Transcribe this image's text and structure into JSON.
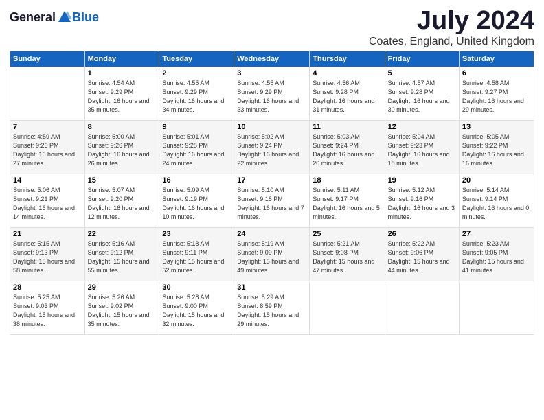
{
  "header": {
    "logo_general": "General",
    "logo_blue": "Blue",
    "month": "July 2024",
    "location": "Coates, England, United Kingdom"
  },
  "days_of_week": [
    "Sunday",
    "Monday",
    "Tuesday",
    "Wednesday",
    "Thursday",
    "Friday",
    "Saturday"
  ],
  "weeks": [
    [
      {
        "day": "",
        "sunrise": "",
        "sunset": "",
        "daylight": ""
      },
      {
        "day": "1",
        "sunrise": "Sunrise: 4:54 AM",
        "sunset": "Sunset: 9:29 PM",
        "daylight": "Daylight: 16 hours and 35 minutes."
      },
      {
        "day": "2",
        "sunrise": "Sunrise: 4:55 AM",
        "sunset": "Sunset: 9:29 PM",
        "daylight": "Daylight: 16 hours and 34 minutes."
      },
      {
        "day": "3",
        "sunrise": "Sunrise: 4:55 AM",
        "sunset": "Sunset: 9:29 PM",
        "daylight": "Daylight: 16 hours and 33 minutes."
      },
      {
        "day": "4",
        "sunrise": "Sunrise: 4:56 AM",
        "sunset": "Sunset: 9:28 PM",
        "daylight": "Daylight: 16 hours and 31 minutes."
      },
      {
        "day": "5",
        "sunrise": "Sunrise: 4:57 AM",
        "sunset": "Sunset: 9:28 PM",
        "daylight": "Daylight: 16 hours and 30 minutes."
      },
      {
        "day": "6",
        "sunrise": "Sunrise: 4:58 AM",
        "sunset": "Sunset: 9:27 PM",
        "daylight": "Daylight: 16 hours and 29 minutes."
      }
    ],
    [
      {
        "day": "7",
        "sunrise": "Sunrise: 4:59 AM",
        "sunset": "Sunset: 9:26 PM",
        "daylight": "Daylight: 16 hours and 27 minutes."
      },
      {
        "day": "8",
        "sunrise": "Sunrise: 5:00 AM",
        "sunset": "Sunset: 9:26 PM",
        "daylight": "Daylight: 16 hours and 26 minutes."
      },
      {
        "day": "9",
        "sunrise": "Sunrise: 5:01 AM",
        "sunset": "Sunset: 9:25 PM",
        "daylight": "Daylight: 16 hours and 24 minutes."
      },
      {
        "day": "10",
        "sunrise": "Sunrise: 5:02 AM",
        "sunset": "Sunset: 9:24 PM",
        "daylight": "Daylight: 16 hours and 22 minutes."
      },
      {
        "day": "11",
        "sunrise": "Sunrise: 5:03 AM",
        "sunset": "Sunset: 9:24 PM",
        "daylight": "Daylight: 16 hours and 20 minutes."
      },
      {
        "day": "12",
        "sunrise": "Sunrise: 5:04 AM",
        "sunset": "Sunset: 9:23 PM",
        "daylight": "Daylight: 16 hours and 18 minutes."
      },
      {
        "day": "13",
        "sunrise": "Sunrise: 5:05 AM",
        "sunset": "Sunset: 9:22 PM",
        "daylight": "Daylight: 16 hours and 16 minutes."
      }
    ],
    [
      {
        "day": "14",
        "sunrise": "Sunrise: 5:06 AM",
        "sunset": "Sunset: 9:21 PM",
        "daylight": "Daylight: 16 hours and 14 minutes."
      },
      {
        "day": "15",
        "sunrise": "Sunrise: 5:07 AM",
        "sunset": "Sunset: 9:20 PM",
        "daylight": "Daylight: 16 hours and 12 minutes."
      },
      {
        "day": "16",
        "sunrise": "Sunrise: 5:09 AM",
        "sunset": "Sunset: 9:19 PM",
        "daylight": "Daylight: 16 hours and 10 minutes."
      },
      {
        "day": "17",
        "sunrise": "Sunrise: 5:10 AM",
        "sunset": "Sunset: 9:18 PM",
        "daylight": "Daylight: 16 hours and 7 minutes."
      },
      {
        "day": "18",
        "sunrise": "Sunrise: 5:11 AM",
        "sunset": "Sunset: 9:17 PM",
        "daylight": "Daylight: 16 hours and 5 minutes."
      },
      {
        "day": "19",
        "sunrise": "Sunrise: 5:12 AM",
        "sunset": "Sunset: 9:16 PM",
        "daylight": "Daylight: 16 hours and 3 minutes."
      },
      {
        "day": "20",
        "sunrise": "Sunrise: 5:14 AM",
        "sunset": "Sunset: 9:14 PM",
        "daylight": "Daylight: 16 hours and 0 minutes."
      }
    ],
    [
      {
        "day": "21",
        "sunrise": "Sunrise: 5:15 AM",
        "sunset": "Sunset: 9:13 PM",
        "daylight": "Daylight: 15 hours and 58 minutes."
      },
      {
        "day": "22",
        "sunrise": "Sunrise: 5:16 AM",
        "sunset": "Sunset: 9:12 PM",
        "daylight": "Daylight: 15 hours and 55 minutes."
      },
      {
        "day": "23",
        "sunrise": "Sunrise: 5:18 AM",
        "sunset": "Sunset: 9:11 PM",
        "daylight": "Daylight: 15 hours and 52 minutes."
      },
      {
        "day": "24",
        "sunrise": "Sunrise: 5:19 AM",
        "sunset": "Sunset: 9:09 PM",
        "daylight": "Daylight: 15 hours and 49 minutes."
      },
      {
        "day": "25",
        "sunrise": "Sunrise: 5:21 AM",
        "sunset": "Sunset: 9:08 PM",
        "daylight": "Daylight: 15 hours and 47 minutes."
      },
      {
        "day": "26",
        "sunrise": "Sunrise: 5:22 AM",
        "sunset": "Sunset: 9:06 PM",
        "daylight": "Daylight: 15 hours and 44 minutes."
      },
      {
        "day": "27",
        "sunrise": "Sunrise: 5:23 AM",
        "sunset": "Sunset: 9:05 PM",
        "daylight": "Daylight: 15 hours and 41 minutes."
      }
    ],
    [
      {
        "day": "28",
        "sunrise": "Sunrise: 5:25 AM",
        "sunset": "Sunset: 9:03 PM",
        "daylight": "Daylight: 15 hours and 38 minutes."
      },
      {
        "day": "29",
        "sunrise": "Sunrise: 5:26 AM",
        "sunset": "Sunset: 9:02 PM",
        "daylight": "Daylight: 15 hours and 35 minutes."
      },
      {
        "day": "30",
        "sunrise": "Sunrise: 5:28 AM",
        "sunset": "Sunset: 9:00 PM",
        "daylight": "Daylight: 15 hours and 32 minutes."
      },
      {
        "day": "31",
        "sunrise": "Sunrise: 5:29 AM",
        "sunset": "Sunset: 8:59 PM",
        "daylight": "Daylight: 15 hours and 29 minutes."
      },
      {
        "day": "",
        "sunrise": "",
        "sunset": "",
        "daylight": ""
      },
      {
        "day": "",
        "sunrise": "",
        "sunset": "",
        "daylight": ""
      },
      {
        "day": "",
        "sunrise": "",
        "sunset": "",
        "daylight": ""
      }
    ]
  ]
}
